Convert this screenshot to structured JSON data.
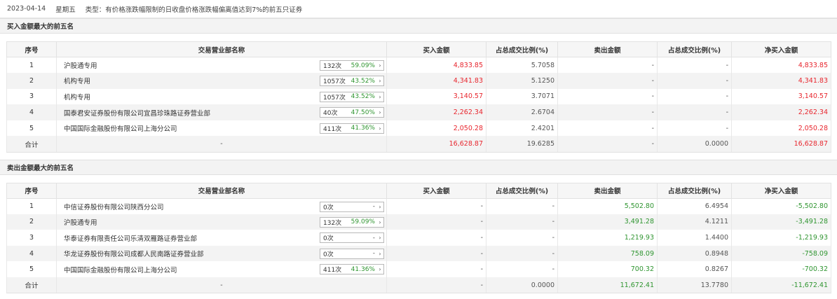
{
  "header": {
    "date": "2023-04-14",
    "weekday": "星期五",
    "type_text": "类型：有价格涨跌幅限制的日收盘价格涨跌幅偏离值达到7%的前五只证券"
  },
  "buy_section": {
    "title": "买入金额最大的前五名",
    "columns": [
      "序号",
      "交易营业部名称",
      "买入金额",
      "占总成交比例(%)",
      "卖出金额",
      "占总成交比例(%)",
      "净买入金额"
    ],
    "rows": [
      {
        "idx": "1",
        "name": "沪股通专用",
        "count": "132次",
        "pct": "59.09%",
        "buy": "4,833.85",
        "buy_ratio": "5.7058",
        "sell": "-",
        "sell_ratio": "-",
        "net": "4,833.85"
      },
      {
        "idx": "2",
        "name": "机构专用",
        "count": "1057次",
        "pct": "43.52%",
        "buy": "4,341.83",
        "buy_ratio": "5.1250",
        "sell": "-",
        "sell_ratio": "-",
        "net": "4,341.83"
      },
      {
        "idx": "3",
        "name": "机构专用",
        "count": "1057次",
        "pct": "43.52%",
        "buy": "3,140.57",
        "buy_ratio": "3.7071",
        "sell": "-",
        "sell_ratio": "-",
        "net": "3,140.57"
      },
      {
        "idx": "4",
        "name": "国泰君安证券股份有限公司宜昌珍珠路证券营业部",
        "count": "40次",
        "pct": "47.50%",
        "buy": "2,262.34",
        "buy_ratio": "2.6704",
        "sell": "-",
        "sell_ratio": "-",
        "net": "2,262.34"
      },
      {
        "idx": "5",
        "name": "中国国际金融股份有限公司上海分公司",
        "count": "411次",
        "pct": "41.36%",
        "buy": "2,050.28",
        "buy_ratio": "2.4201",
        "sell": "-",
        "sell_ratio": "-",
        "net": "2,050.28"
      }
    ],
    "total": {
      "label": "合计",
      "name": "-",
      "buy": "16,628.87",
      "buy_ratio": "19.6285",
      "sell": "-",
      "sell_ratio": "0.0000",
      "net": "16,628.87"
    }
  },
  "sell_section": {
    "title": "卖出金额最大的前五名",
    "columns": [
      "序号",
      "交易营业部名称",
      "买入金额",
      "占总成交比例(%)",
      "卖出金额",
      "占总成交比例(%)",
      "净买入金额"
    ],
    "rows": [
      {
        "idx": "1",
        "name": "中信证券股份有限公司陕西分公司",
        "count": "0次",
        "pct": "-",
        "buy": "-",
        "buy_ratio": "-",
        "sell": "5,502.80",
        "sell_ratio": "6.4954",
        "net": "-5,502.80"
      },
      {
        "idx": "2",
        "name": "沪股通专用",
        "count": "132次",
        "pct": "59.09%",
        "buy": "-",
        "buy_ratio": "-",
        "sell": "3,491.28",
        "sell_ratio": "4.1211",
        "net": "-3,491.28"
      },
      {
        "idx": "3",
        "name": "华泰证券有限责任公司乐清双雁路证券营业部",
        "count": "0次",
        "pct": "-",
        "buy": "-",
        "buy_ratio": "-",
        "sell": "1,219.93",
        "sell_ratio": "1.4400",
        "net": "-1,219.93"
      },
      {
        "idx": "4",
        "name": "华龙证券股份有限公司成都人民南路证券营业部",
        "count": "0次",
        "pct": "-",
        "buy": "-",
        "buy_ratio": "-",
        "sell": "758.09",
        "sell_ratio": "0.8948",
        "net": "-758.09"
      },
      {
        "idx": "5",
        "name": "中国国际金融股份有限公司上海分公司",
        "count": "411次",
        "pct": "41.36%",
        "buy": "-",
        "buy_ratio": "-",
        "sell": "700.32",
        "sell_ratio": "0.8267",
        "net": "-700.32"
      }
    ],
    "total": {
      "label": "合计",
      "name": "-",
      "buy": "-",
      "buy_ratio": "0.0000",
      "sell": "11,672.41",
      "sell_ratio": "13.7780",
      "net": "-11,672.41"
    }
  },
  "colors": {
    "up": "#e8262e",
    "down": "#2f9530"
  }
}
